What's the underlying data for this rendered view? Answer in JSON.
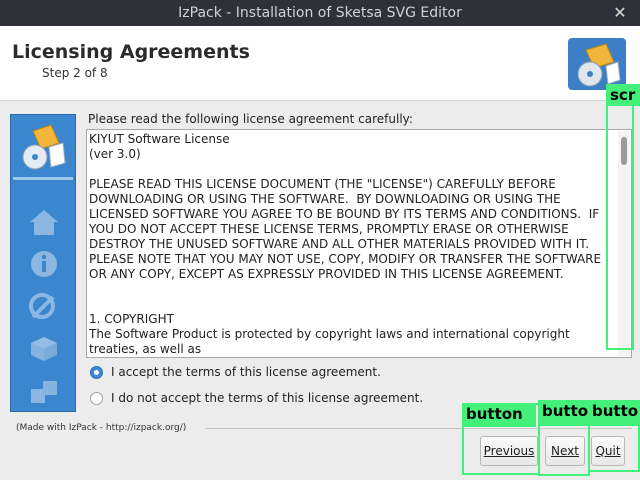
{
  "window": {
    "title": "IzPack - Installation of Sketsa SVG Editor",
    "close_glyph": "✕"
  },
  "header": {
    "title": "Licensing Agreements",
    "step": "Step 2 of 8"
  },
  "content": {
    "prompt": "Please read the following license agreement carefully:",
    "license_text": "KIYUT Software License\n(ver 3.0)\n\nPLEASE READ THIS LICENSE DOCUMENT (THE \"LICENSE\") CAREFULLY BEFORE\nDOWNLOADING OR USING THE SOFTWARE.  BY DOWNLOADING OR USING THE\nLICENSED SOFTWARE YOU AGREE TO BE BOUND BY ITS TERMS AND CONDITIONS.  IF\nYOU DO NOT ACCEPT THESE LICENSE TERMS, PROMPTLY ERASE OR OTHERWISE\nDESTROY THE UNUSED SOFTWARE AND ALL OTHER MATERIALS PROVIDED WITH IT.\nPLEASE NOTE THAT YOU MAY NOT USE, COPY, MODIFY OR TRANSFER THE SOFTWARE\nOR ANY COPY, EXCEPT AS EXPRESSLY PROVIDED IN THIS LICENSE AGREEMENT.\n\n\n1. COPYRIGHT\nThe Software Product is protected by copyright laws and international copyright treaties, as well as\nother intellectual property laws and treaties. Any use of this software in violation of copyright law or",
    "accept_label": "I accept the terms of this license agreement.",
    "decline_label": "I do not accept the terms of this license agreement.",
    "accept_selected": true
  },
  "footer": {
    "made_with": "(Made with IzPack - http://izpack.org/)",
    "previous_label": "Previous",
    "next_label": "Next",
    "quit_label": "Quit"
  },
  "annotations": {
    "scrollbar_label": "scr",
    "button_label": "button",
    "next_button_label": "butto",
    "quit_button_label": "butto"
  },
  "colors": {
    "overlay": "#44f07a",
    "sidebar": "#3a86cf",
    "titlebar": "#2e3238"
  }
}
